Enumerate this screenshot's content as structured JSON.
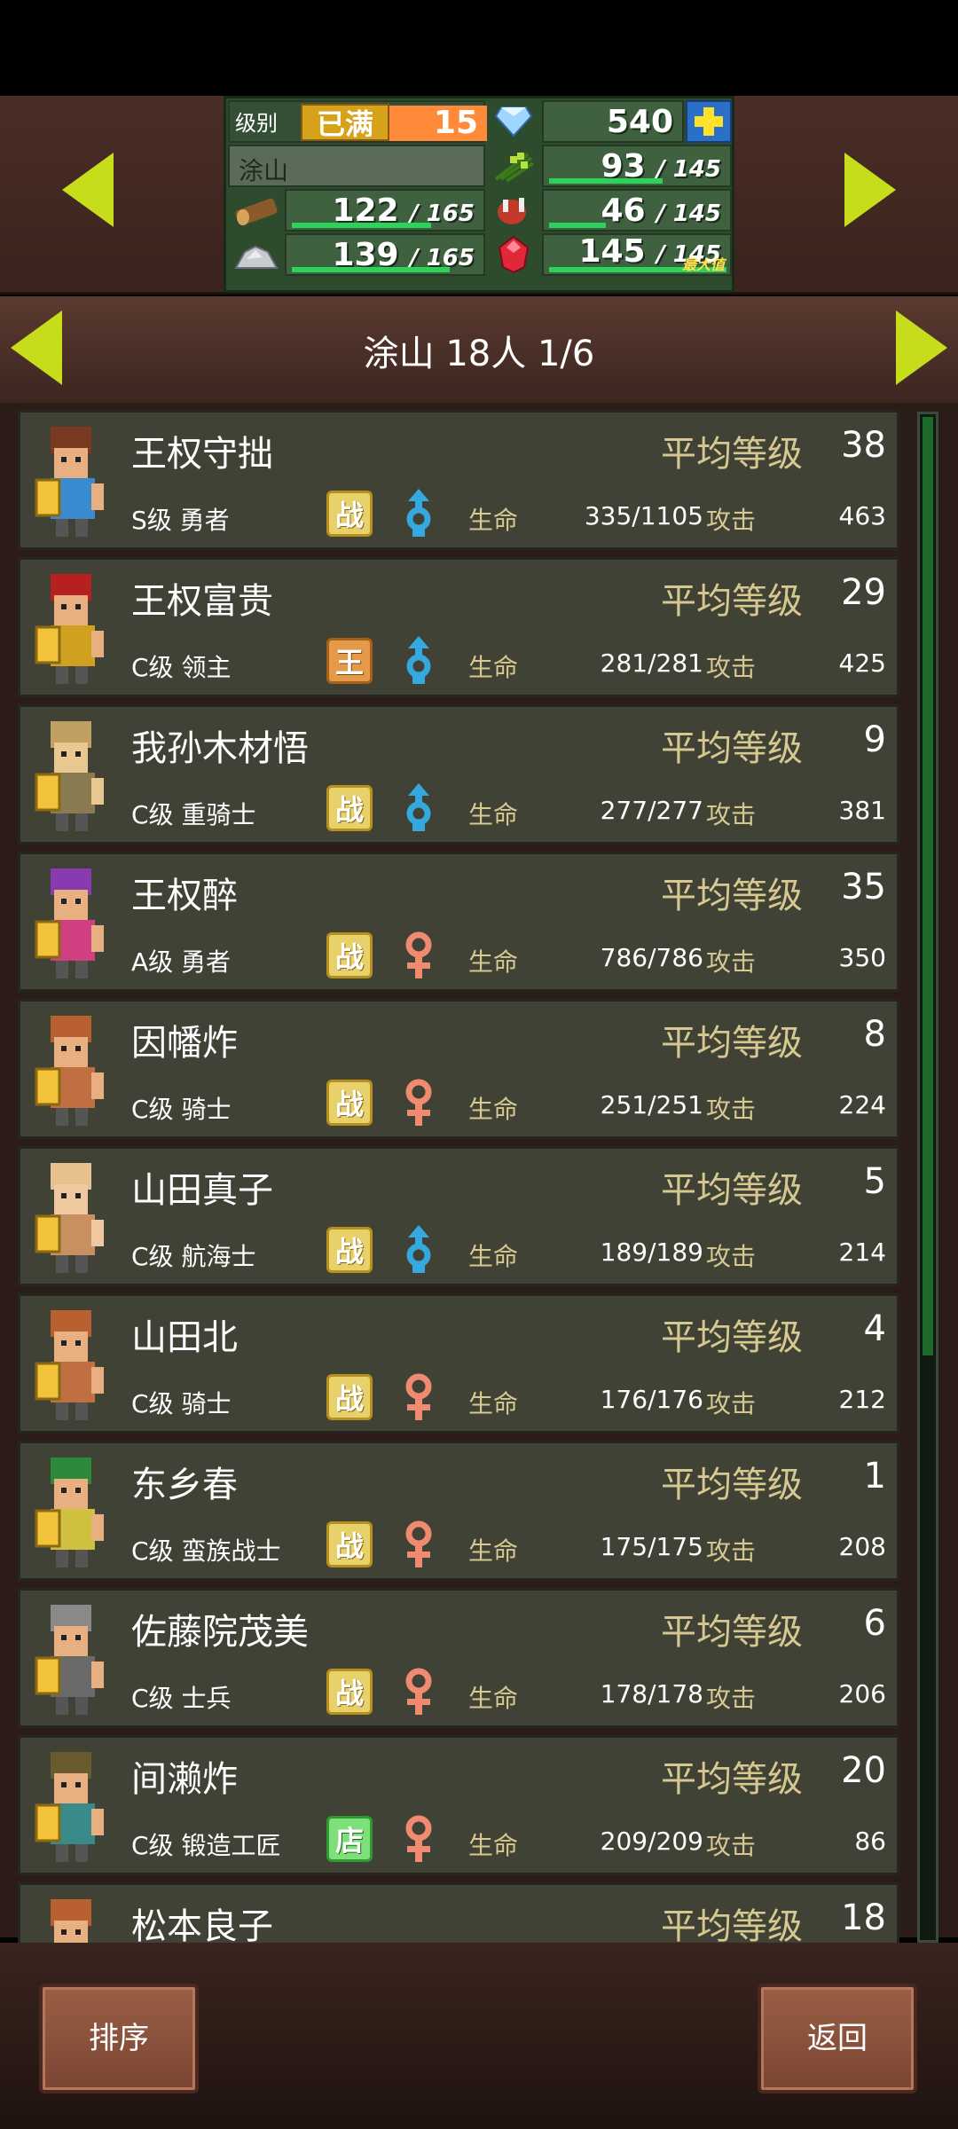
{
  "header": {
    "level_label": "级别",
    "level_badge": "已满",
    "level_value": "15",
    "gems": "540",
    "town_name": "涂山",
    "food": {
      "current": "93",
      "max": "145",
      "fill": 0.64
    },
    "wood": {
      "current": "122",
      "max": "165",
      "fill": 0.74
    },
    "meat": {
      "current": "46",
      "max": "145",
      "fill": 0.32
    },
    "stone": {
      "current": "139",
      "max": "165",
      "fill": 0.84
    },
    "ruby": {
      "current": "145",
      "max": "145",
      "fill": 1.0,
      "tag": "最大值"
    }
  },
  "city_title": "涂山  18人 1/6",
  "labels": {
    "avg_level": "平均等级",
    "hp": "生命",
    "atk": "攻击"
  },
  "members": [
    {
      "name": "王权守拙",
      "class": "S级 勇者",
      "badge": "战",
      "badge_type": "zhan",
      "gender": "male",
      "avg": "38",
      "hp": "335/1105",
      "atk": "463"
    },
    {
      "name": "王权富贵",
      "class": "C级 领主",
      "badge": "王",
      "badge_type": "wang",
      "gender": "male",
      "avg": "29",
      "hp": "281/281",
      "atk": "425"
    },
    {
      "name": "我孙木材悟",
      "class": "C级 重骑士",
      "badge": "战",
      "badge_type": "zhan",
      "gender": "male",
      "avg": "9",
      "hp": "277/277",
      "atk": "381"
    },
    {
      "name": "王权醉",
      "class": "A级 勇者",
      "badge": "战",
      "badge_type": "zhan",
      "gender": "female",
      "avg": "35",
      "hp": "786/786",
      "atk": "350"
    },
    {
      "name": "因幡炸",
      "class": "C级 骑士",
      "badge": "战",
      "badge_type": "zhan",
      "gender": "female",
      "avg": "8",
      "hp": "251/251",
      "atk": "224"
    },
    {
      "name": "山田真子",
      "class": "C级 航海士",
      "badge": "战",
      "badge_type": "zhan",
      "gender": "male",
      "avg": "5",
      "hp": "189/189",
      "atk": "214"
    },
    {
      "name": "山田北",
      "class": "C级 骑士",
      "badge": "战",
      "badge_type": "zhan",
      "gender": "female",
      "avg": "4",
      "hp": "176/176",
      "atk": "212"
    },
    {
      "name": "东乡春",
      "class": "C级 蛮族战士",
      "badge": "战",
      "badge_type": "zhan",
      "gender": "female",
      "avg": "1",
      "hp": "175/175",
      "atk": "208"
    },
    {
      "name": "佐藤院茂美",
      "class": "C级 士兵",
      "badge": "战",
      "badge_type": "zhan",
      "gender": "female",
      "avg": "6",
      "hp": "178/178",
      "atk": "206"
    },
    {
      "name": "间濑炸",
      "class": "C级 锻造工匠",
      "badge": "店",
      "badge_type": "dian",
      "gender": "female",
      "avg": "20",
      "hp": "209/209",
      "atk": "86"
    },
    {
      "name": "松本良子",
      "class": "",
      "badge": "",
      "badge_type": "zhan",
      "gender": "female",
      "avg": "18",
      "hp": "",
      "atk": ""
    }
  ],
  "buttons": {
    "sort": "排序",
    "back": "返回"
  },
  "colors": {
    "accent_arrow": "#c7dc1a",
    "hp_bar": "#2bd35a",
    "male": "#35a8e0",
    "female": "#f08a70"
  }
}
